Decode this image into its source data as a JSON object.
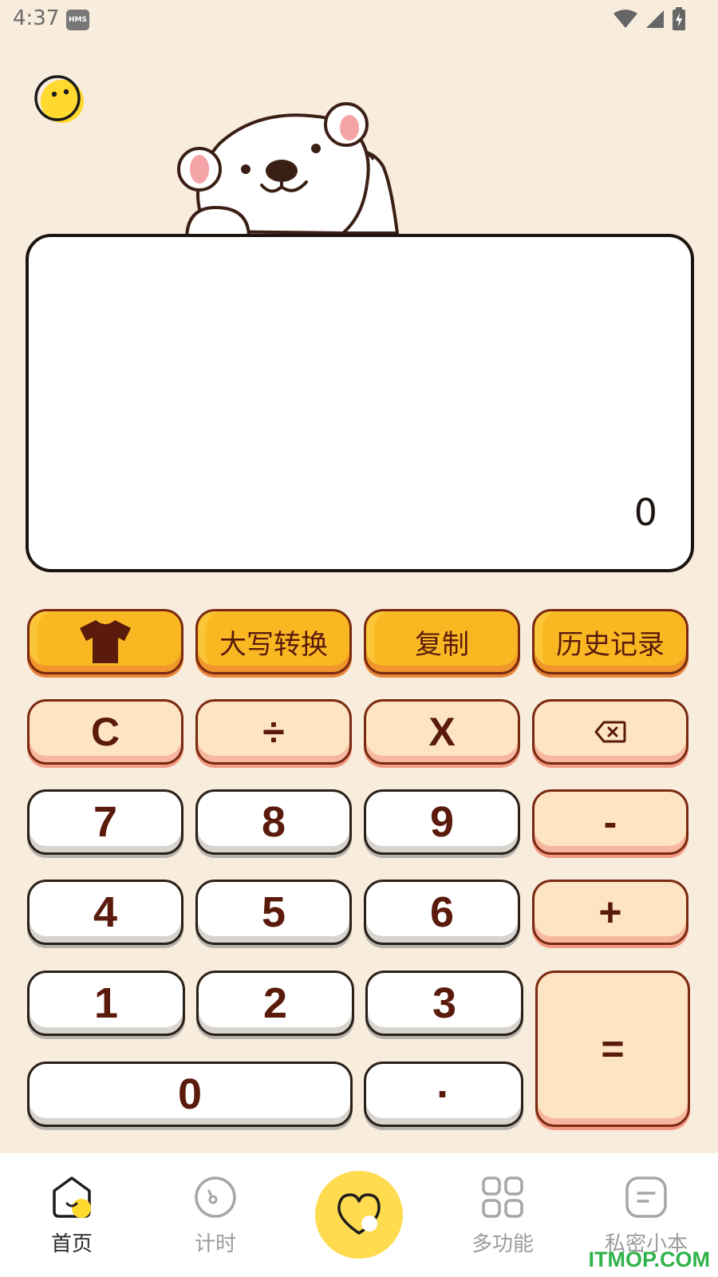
{
  "status_bar": {
    "time": "4:37",
    "badge": "HMS",
    "icons": [
      "wifi-icon",
      "signal-icon",
      "battery-charging-icon"
    ]
  },
  "display": {
    "value": "0"
  },
  "function_row": {
    "theme_icon": "tshirt-icon",
    "uppercase_label": "大写转换",
    "copy_label": "复制",
    "history_label": "历史记录"
  },
  "keys": {
    "clear": "C",
    "divide": "÷",
    "multiply": "X",
    "backspace_icon": "backspace-icon",
    "seven": "7",
    "eight": "8",
    "nine": "9",
    "minus": "-",
    "four": "4",
    "five": "5",
    "six": "6",
    "plus": "+",
    "one": "1",
    "two": "2",
    "three": "3",
    "equals": "=",
    "zero": "0",
    "dot": "·"
  },
  "nav": {
    "home": "首页",
    "timer": "计时",
    "center_icon": "heart-icon",
    "multi": "多功能",
    "notes": "私密小本"
  },
  "watermark": "ITMOP.COM",
  "colors": {
    "background": "#f8ecdc",
    "function_key": "#f9b822",
    "operator_key": "#fde4c3",
    "number_key": "#ffffff",
    "key_text": "#5a1a0c",
    "fab": "#ffdb4f",
    "watermark": "#2fb34a"
  }
}
